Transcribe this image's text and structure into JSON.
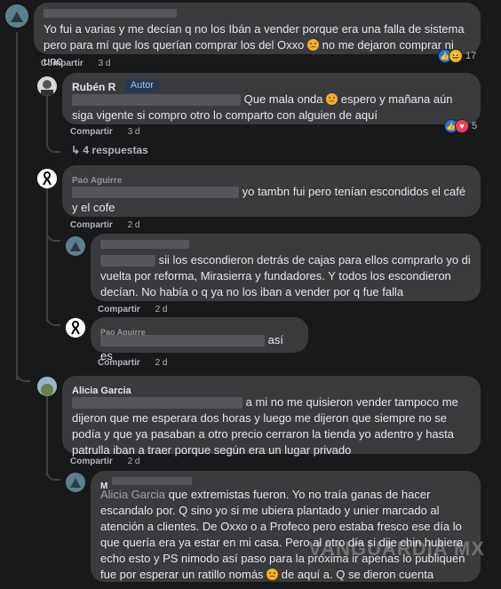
{
  "comments": [
    {
      "author": "",
      "text": "Yo fui a varias y me decían q no los Ibán a vender porque era una falla de sistema pero para mí que los querían comprar los del Oxxo",
      "text_after_emoji": "no me dejaron comprar ni uno",
      "share_label": "Compartir",
      "time": "3 d",
      "reaction_count": "17"
    },
    {
      "author": "Rubén R",
      "badge": "Autor",
      "text": "Que mala onda",
      "text_after_emoji": "espero y mañana aún siga vigente si compro otro lo comparto con alguien de aquí",
      "share_label": "Compartir",
      "time": "3 d",
      "reaction_count": "5",
      "replies_label": "4 respuestas"
    },
    {
      "author": "Pao Aguirre",
      "text": "yo tambn fui pero tenían escondidos el café y el cofe",
      "share_label": "Compartir",
      "time": "2 d"
    },
    {
      "author": "",
      "text": "sii los escondieron detrás de cajas para ellos comprarlo yo di vuelta por reforma, Mirasierra y fundadores. Y todos los escondieron decían. No había o q ya no los iban a vender por q fue falla",
      "share_label": "Compartir",
      "time": "2 d"
    },
    {
      "author": "Pao Aguirre",
      "text": "así es",
      "share_label": "Compartir",
      "time": "2 d"
    },
    {
      "author": "Alicia Garcia",
      "text": "a mi no me quisieron vender tampoco me dijeron que me esperara dos horas y luego me dijeron que siempre no se podía y que ya pasaban a otro precio cerraron la tienda yo adentro y hasta patrulla iban a traer porque según era un lugar privado",
      "share_label": "Compartir",
      "time": "2 d"
    },
    {
      "author": "M",
      "mention": "Alicia Garcia",
      "text": "que extremistas fueron. Yo no traía ganas de hacer escandalo por. Q sino yo si me ubiera plantado y unier marcado al atención a clientes. De Oxxo o a Profeco pero estaba fresco ese día lo que quería era ya estar en mi casa. Pero al otro día si dije chin hubiera echo esto y PS nimodo así paso para la próxima ir apenas lo publiquen fue por esperar un ratillo nomás",
      "text_after_emoji": "de aquí a. Q se dieron cuenta"
    }
  ],
  "watermark": "VANGUARDIA MX",
  "colors": {
    "background": "#18191a",
    "bubble": "#3a3b3c",
    "text": "#e4e6eb",
    "meta": "#b0b3b8",
    "like": "#1877f2",
    "love": "#f33e58",
    "haha": "#f7b125"
  }
}
